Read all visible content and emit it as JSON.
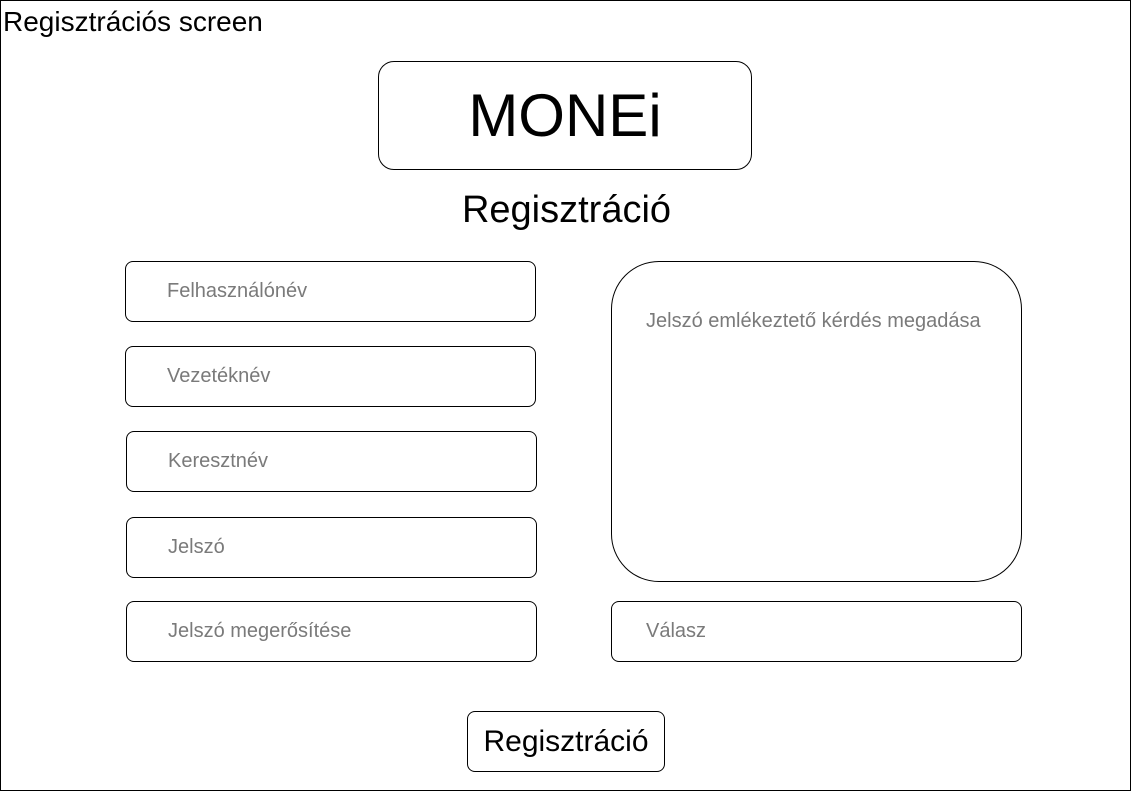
{
  "screen": {
    "title": "Regisztrációs screen"
  },
  "logo": {
    "text": "MONEi"
  },
  "heading": "Regisztráció",
  "form": {
    "username": {
      "placeholder": "Felhasználónév",
      "value": ""
    },
    "last_name": {
      "placeholder": "Vezetéknév",
      "value": ""
    },
    "first_name": {
      "placeholder": "Keresztnév",
      "value": ""
    },
    "password": {
      "placeholder": "Jelszó",
      "value": ""
    },
    "password_confirm": {
      "placeholder": "Jelszó megerősítése",
      "value": ""
    },
    "security_question": {
      "placeholder": "Jelszó emlékeztető kérdés megadása",
      "value": ""
    },
    "answer": {
      "placeholder": "Válasz",
      "value": ""
    }
  },
  "submit": {
    "label": "Regisztráció"
  }
}
